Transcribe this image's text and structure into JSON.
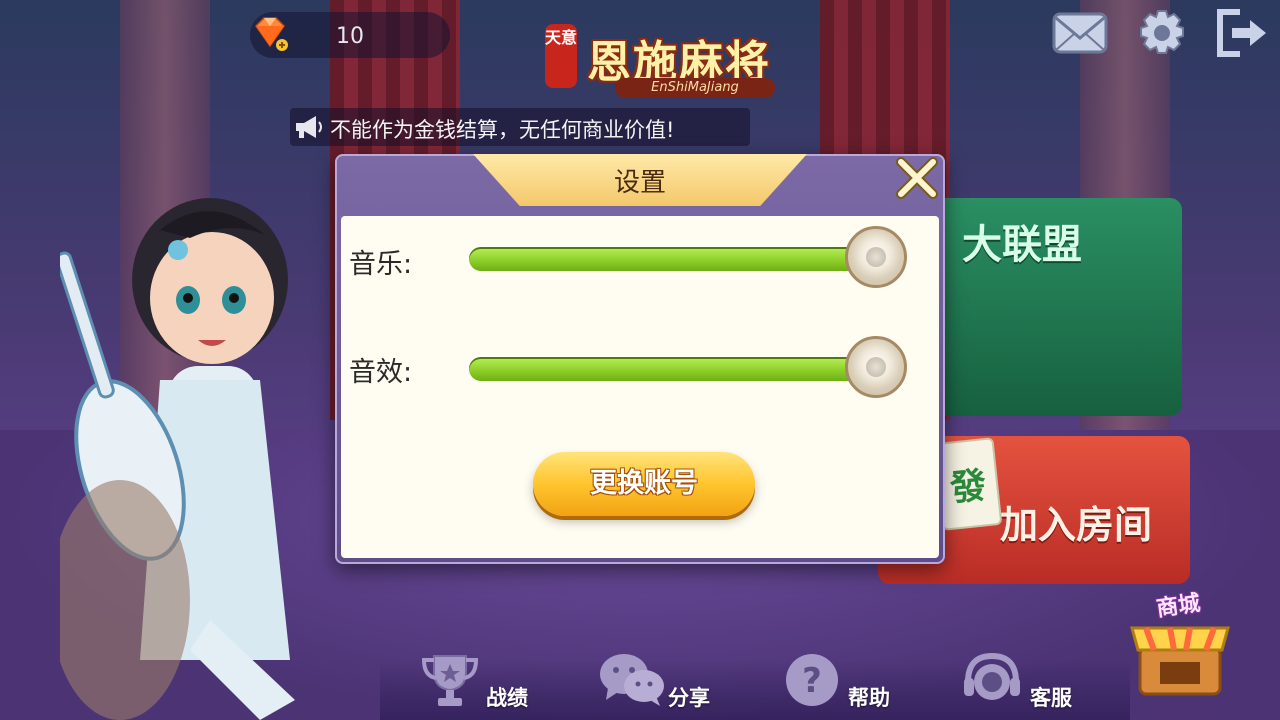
{
  "top_bar": {
    "gem_count": "10",
    "logo": {
      "seal": "天意",
      "title": "恩施麻将",
      "subtitle": "EnShiMaJiang"
    }
  },
  "marquee": {
    "text": "不能作为金钱结算，无任何商业价值!"
  },
  "cards": {
    "alliance_title": "大联盟",
    "join_room_title": "加入房间",
    "tile_glyph": "發"
  },
  "shop": {
    "label": "商城"
  },
  "bottom_nav": {
    "record": "战绩",
    "share": "分享",
    "help": "帮助",
    "service": "客服"
  },
  "settings_modal": {
    "title": "设置",
    "music_label": "音乐:",
    "music_level": 1.0,
    "sfx_label": "音效:",
    "sfx_level": 1.0,
    "switch_account_label": "更换账号"
  },
  "colors": {
    "slider_green": "#8ed02a",
    "button_gold": "#ffc52e",
    "modal_purple": "#6e5c99",
    "panel_cream": "#fffcf1"
  }
}
